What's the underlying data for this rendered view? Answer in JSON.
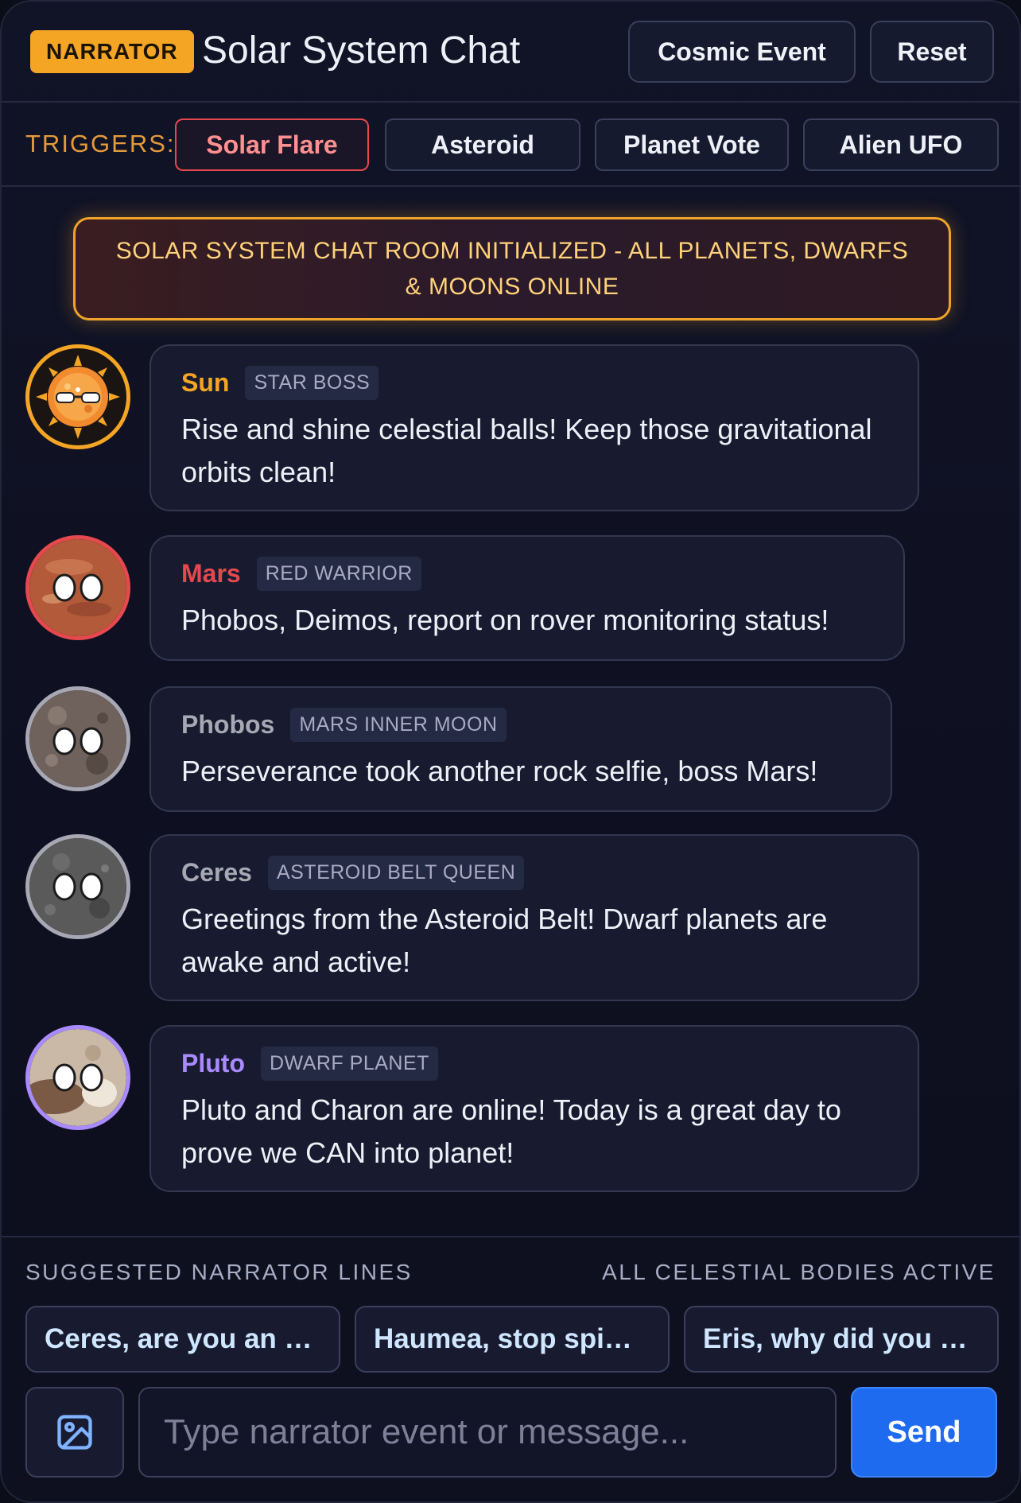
{
  "header": {
    "badge": "NARRATOR",
    "title": "Solar System Chat",
    "buttons": {
      "cosmic_event": "Cosmic Event",
      "reset": "Reset"
    }
  },
  "triggers": {
    "label": "TRIGGERS:",
    "items": [
      "Solar Flare",
      "Asteroid",
      "Planet Vote",
      "Alien UFO"
    ],
    "active": "Solar Flare"
  },
  "system_message": "SOLAR SYSTEM CHAT ROOM INITIALIZED - ALL PLANETS, DWARFS & MOONS ONLINE",
  "messages": [
    {
      "sender": "Sun",
      "role": "STAR BOSS",
      "text": "Rise and shine celestial balls! Keep those gravitational orbits clean!",
      "color": "#f5a524",
      "avatar_icon": "sun-with-sunglasses-icon"
    },
    {
      "sender": "Mars",
      "role": "RED WARRIOR",
      "text": "Phobos, Deimos, report on rover monitoring status!",
      "color": "#e5484d",
      "avatar_icon": "mars-planet-icon"
    },
    {
      "sender": "Phobos",
      "role": "MARS INNER MOON",
      "text": "Perseverance took another rock selfie, boss Mars!",
      "color": "#a8a8b4",
      "avatar_icon": "phobos-moon-icon"
    },
    {
      "sender": "Ceres",
      "role": "ASTEROID BELT QUEEN",
      "text": "Greetings from the Asteroid Belt! Dwarf planets are awake and active!",
      "color": "#a8a8b4",
      "avatar_icon": "ceres-dwarf-planet-icon"
    },
    {
      "sender": "Pluto",
      "role": "DWARF PLANET",
      "text": "Pluto and Charon are online! Today is a great day to prove we CAN into planet!",
      "color": "#a98bff",
      "avatar_icon": "pluto-dwarf-planet-icon"
    }
  ],
  "footer": {
    "suggested_label": "SUGGESTED NARRATOR LINES",
    "status": "ALL CELESTIAL BODIES ACTIVE",
    "suggestions": [
      "Ceres, are you an …",
      "Haumea, stop spi…",
      "Eris, why did you …"
    ],
    "input_placeholder": "Type narrator event or message...",
    "input_value": "",
    "send_label": "Send",
    "image_icon": "image-icon"
  }
}
